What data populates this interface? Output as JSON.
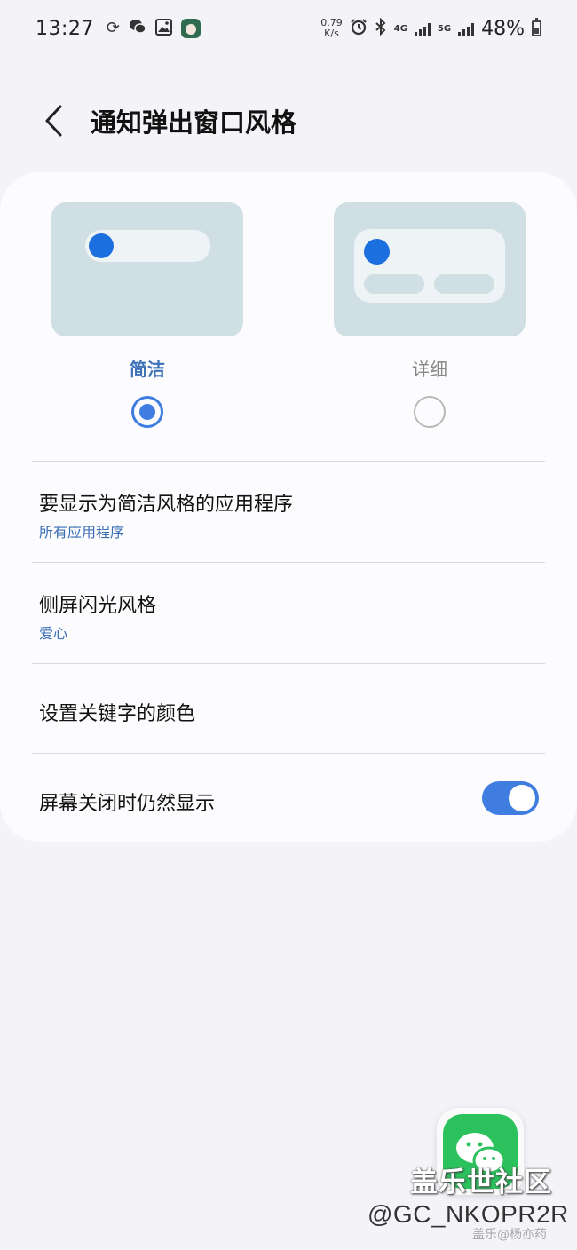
{
  "status_bar": {
    "time": "13:27",
    "speed_value": "0.79",
    "speed_unit": "K/s",
    "net1": "4G",
    "net2": "5G",
    "battery": "48%"
  },
  "header": {
    "title": "通知弹出窗口风格"
  },
  "styles": {
    "options": [
      {
        "label": "简洁",
        "selected": true
      },
      {
        "label": "详细",
        "selected": false
      }
    ]
  },
  "settings": {
    "items": [
      {
        "title": "要显示为简洁风格的应用程序",
        "subtitle": "所有应用程序"
      },
      {
        "title": "侧屏闪光风格",
        "subtitle": "爱心"
      },
      {
        "title": "设置关键字的颜色"
      },
      {
        "title": "屏幕关闭时仍然显示",
        "toggle_on": true
      }
    ]
  },
  "watermark": {
    "brand": "盖乐世社区",
    "handle": "@GC_NKOPR2R",
    "small": "盖乐@杨亦药"
  },
  "colors": {
    "accent": "#3f7de0",
    "preview_bg": "#cfdfe4",
    "subtitle": "#3a6fb5"
  }
}
